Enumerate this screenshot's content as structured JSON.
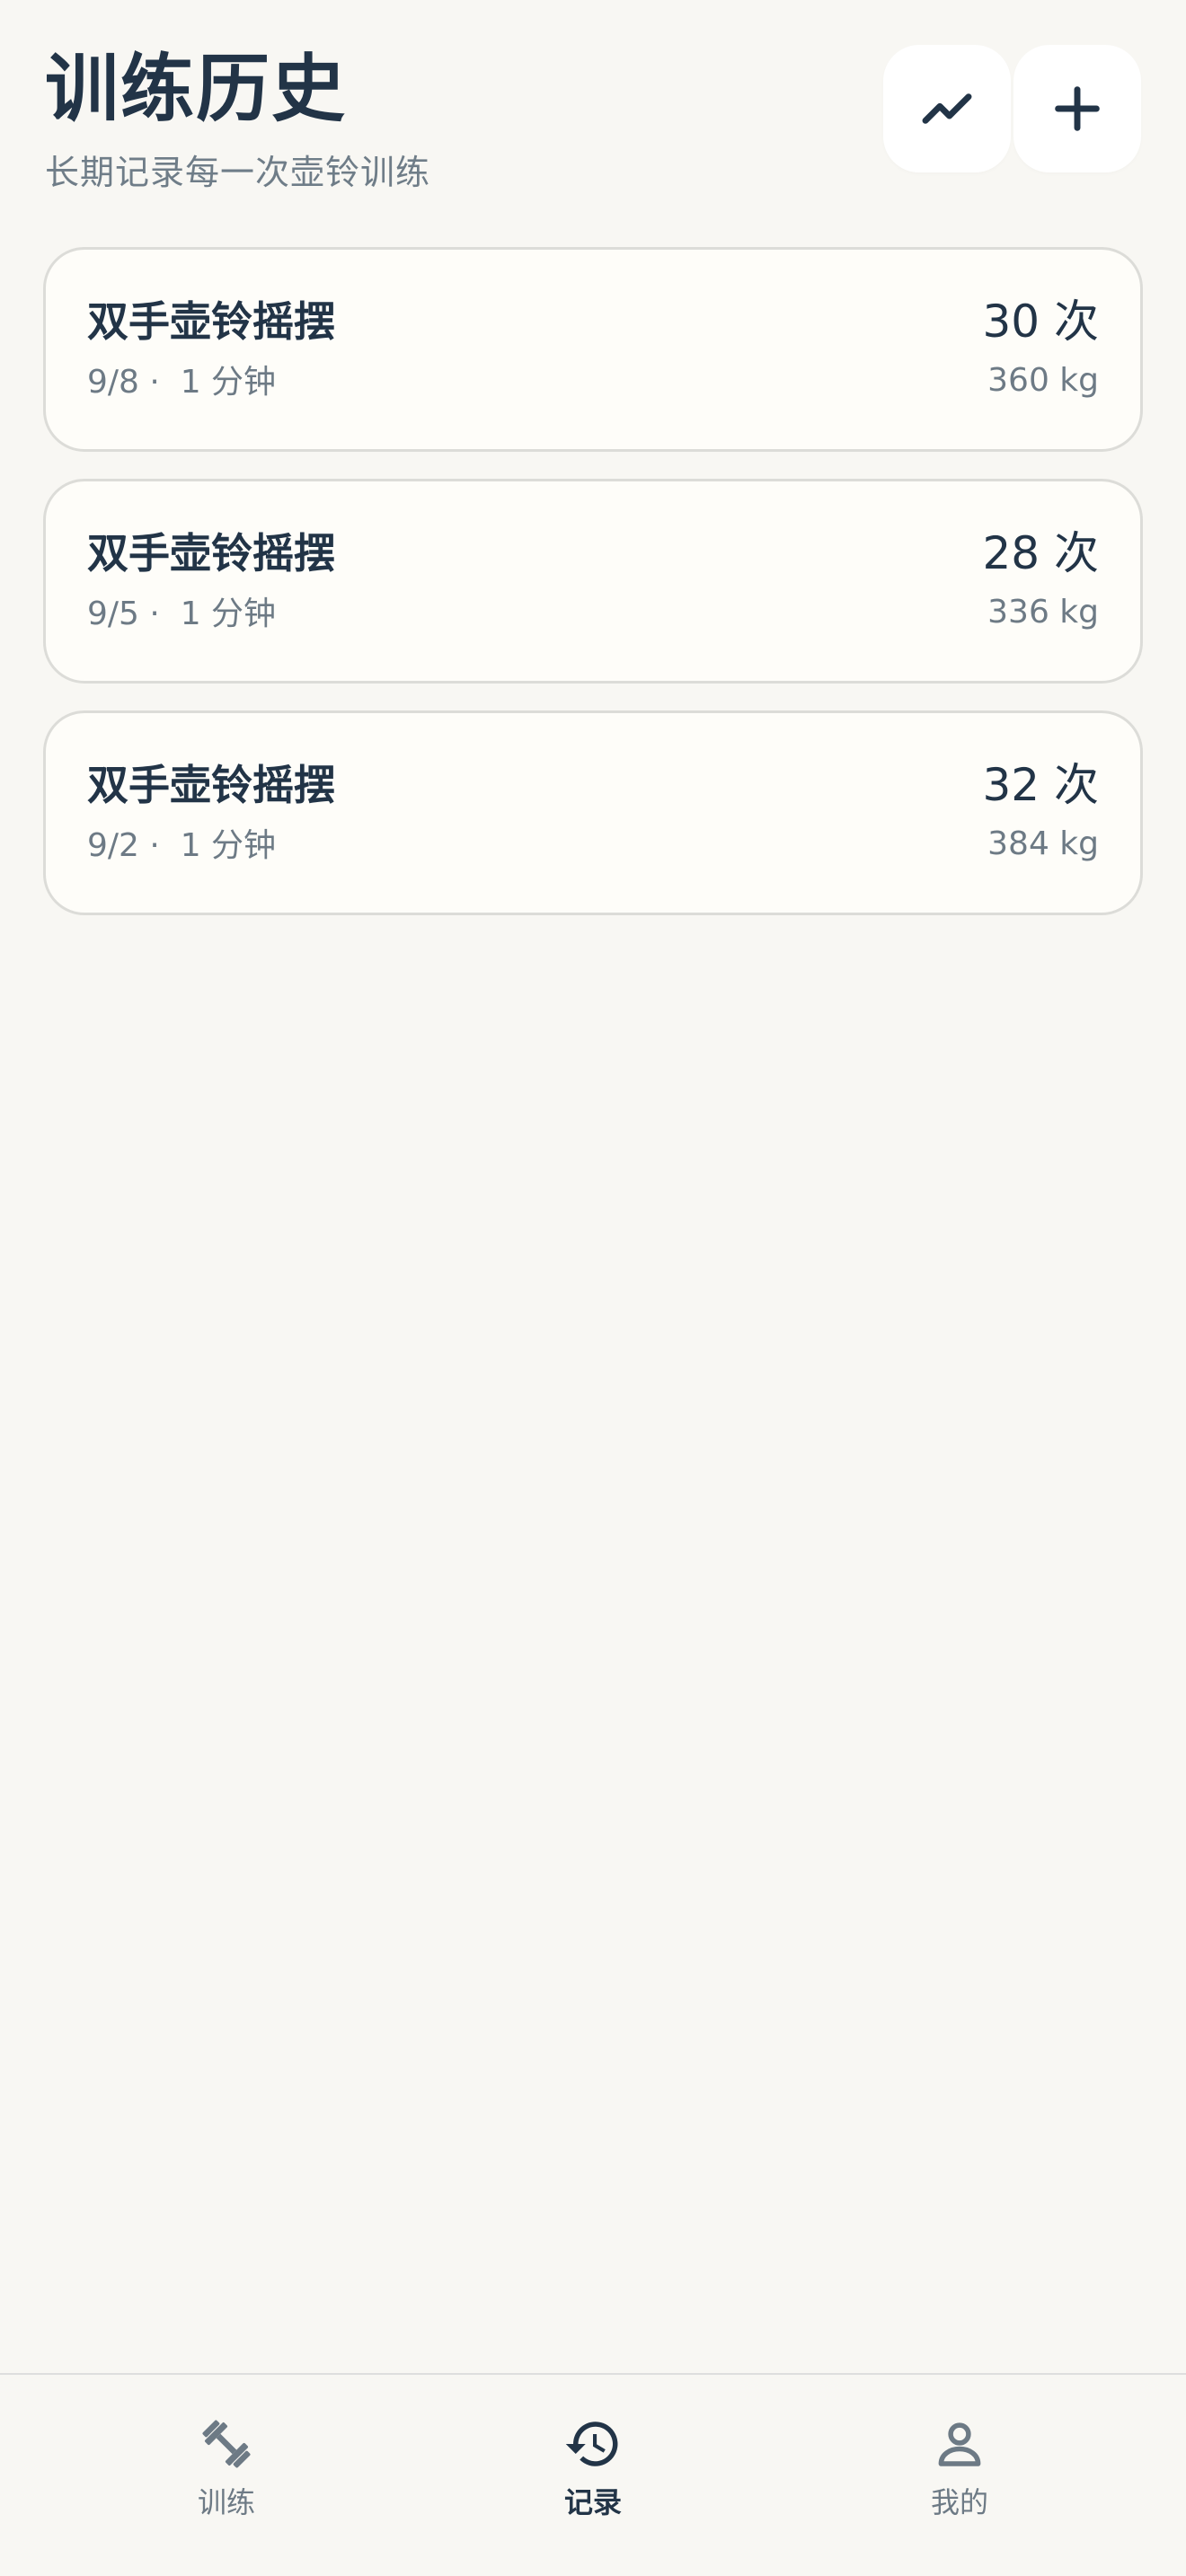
{
  "header": {
    "title": "训练历史",
    "subtitle": "长期记录每一次壶铃训练",
    "stats_button_icon": "trend-chart-icon",
    "add_button_icon": "plus-icon"
  },
  "sessions": [
    {
      "name": "双手壶铃摇摆",
      "meta": "9/8 ·  1 分钟",
      "reps": "30 次",
      "weight": "360 kg"
    },
    {
      "name": "双手壶铃摇摆",
      "meta": "9/5 ·  1 分钟",
      "reps": "28 次",
      "weight": "336 kg"
    },
    {
      "name": "双手壶铃摇摆",
      "meta": "9/2 ·  1 分钟",
      "reps": "32 次",
      "weight": "384 kg"
    }
  ],
  "nav": {
    "items": [
      {
        "label": "训练",
        "icon": "dumbbell-icon",
        "active": false
      },
      {
        "label": "记录",
        "icon": "history-icon",
        "active": true
      },
      {
        "label": "我的",
        "icon": "person-icon",
        "active": false
      }
    ]
  },
  "colors": {
    "background": "#f8f7f3",
    "card": "#fefdf9",
    "primary_text": "#223447",
    "secondary_text": "#6d7a85"
  }
}
